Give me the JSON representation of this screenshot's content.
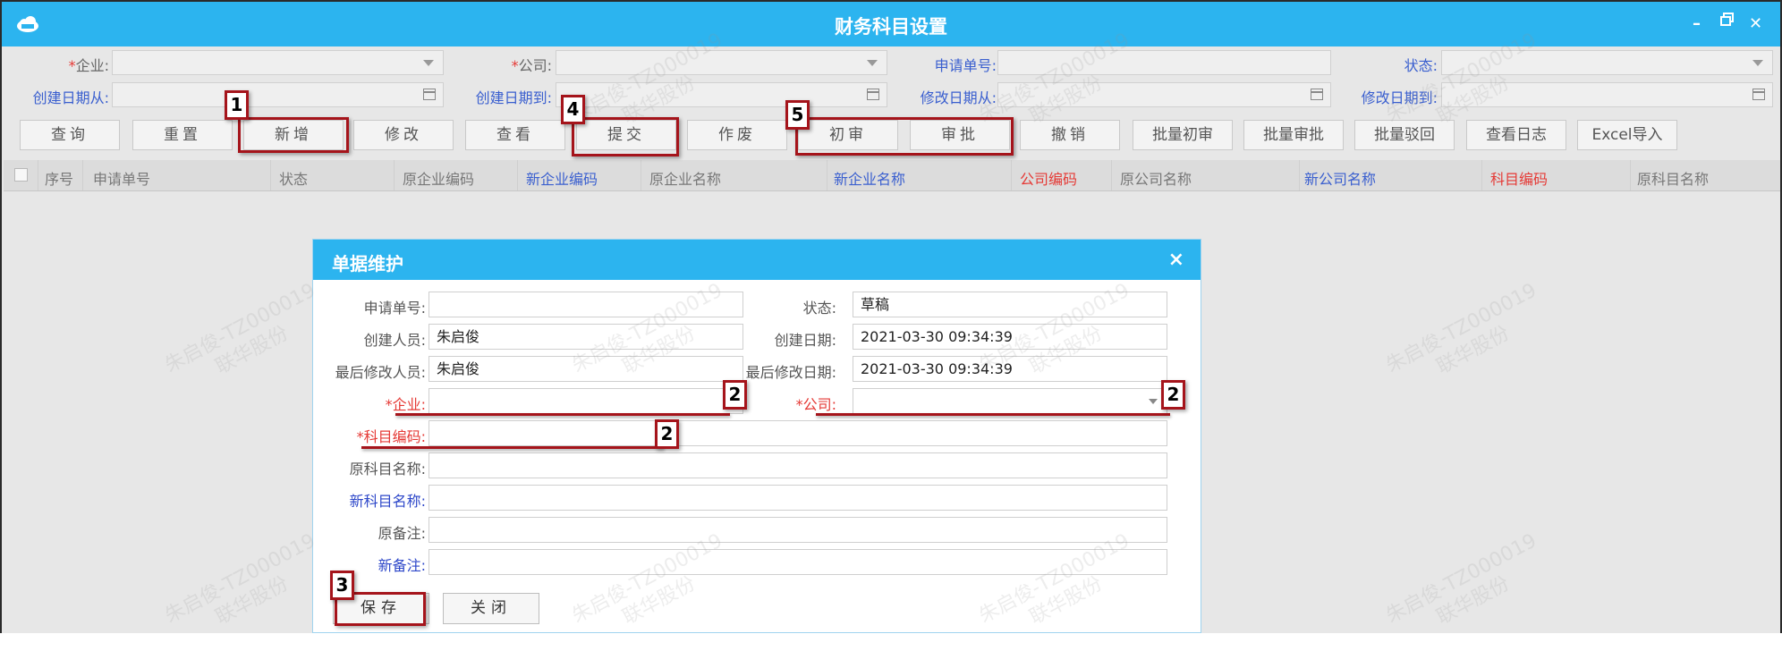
{
  "window": {
    "title": "财务科目设置"
  },
  "filters": {
    "enterprise": {
      "required": "*",
      "label": "企业:"
    },
    "company": {
      "required": "*",
      "label": "公司:"
    },
    "request_no": {
      "label": "申请单号:"
    },
    "status": {
      "label": "状态:"
    },
    "created_from": {
      "label": "创建日期从:"
    },
    "created_to": {
      "label": "创建日期到:"
    },
    "modified_from": {
      "label": "修改日期从:"
    },
    "modified_to": {
      "label": "修改日期到:"
    }
  },
  "toolbar": {
    "query": "查询",
    "reset": "重置",
    "add": "新增",
    "edit": "修改",
    "view": "查看",
    "submit": "提交",
    "void": "作废",
    "first_review": "初审",
    "approve": "审批",
    "revoke": "撤销",
    "batch_first_review": "批量初审",
    "batch_approve": "批量审批",
    "batch_reject": "批量驳回",
    "view_log": "查看日志",
    "excel_import": "Excel导入"
  },
  "table": {
    "columns": [
      "序号",
      "申请单号",
      "状态",
      "原企业编码",
      "新企业编码",
      "原企业名称",
      "新企业名称",
      "公司编码",
      "原公司名称",
      "新公司名称",
      "科目编码",
      "原科目名称"
    ]
  },
  "dialog": {
    "title": "单据维护",
    "close_symbol": "×",
    "labels": {
      "request_no": "申请单号:",
      "status": "状态:",
      "creator": "创建人员:",
      "create_date": "创建日期:",
      "last_modifier": "最后修改人员:",
      "last_modify_date": "最后修改日期:",
      "enterprise": "*企业:",
      "company": "*公司:",
      "subject_code": "*科目编码:",
      "orig_subject_name": "原科目名称:",
      "new_subject_name": "新科目名称:",
      "orig_remark": "原备注:",
      "new_remark": "新备注:"
    },
    "values": {
      "request_no": "",
      "status": "草稿",
      "creator": "朱启俊",
      "create_date": "2021-03-30 09:34:39",
      "last_modifier": "朱启俊",
      "last_modify_date": "2021-03-30 09:34:39",
      "enterprise": "",
      "company": "",
      "subject_code": "",
      "orig_subject_name": "",
      "new_subject_name": "",
      "orig_remark": "",
      "new_remark": ""
    },
    "buttons": {
      "save": "保存",
      "close": "关闭"
    }
  },
  "watermark": {
    "line1": "朱启俊-TZ000019",
    "line2": "联华股份"
  },
  "annotations": [
    "1",
    "2",
    "2",
    "2",
    "3",
    "4",
    "5"
  ],
  "colors": {
    "header_blue": "#2cb4ef",
    "annotation_red": "#a5141b",
    "required_red": "#e53935",
    "label_blue": "#3a5fcf"
  }
}
